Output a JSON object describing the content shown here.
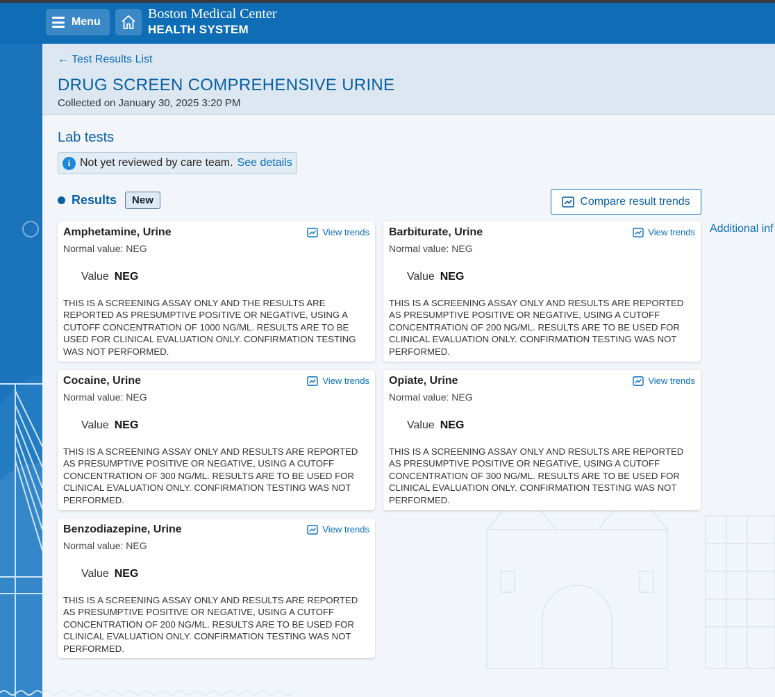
{
  "header": {
    "menu_label": "Menu",
    "logo_line1": "Boston Medical Center",
    "logo_line2": "HEALTH SYSTEM"
  },
  "page": {
    "back_link": "Test Results List",
    "title": "DRUG SCREEN COMPREHENSIVE URINE",
    "collected": "Collected on January 30, 2025 3:20 PM",
    "section_title": "Lab tests",
    "notice_text": "Not yet reviewed by care team.",
    "notice_link": "See details",
    "results_label": "Results",
    "results_badge": "New",
    "compare_button": "Compare result trends",
    "additional_link": "Additional inf"
  },
  "results": [
    {
      "name": "Amphetamine, Urine",
      "trends_label": "View trends",
      "normal": "Normal value: NEG",
      "value_label": "Value",
      "value": "NEG",
      "comment": "THIS IS A SCREENING ASSAY ONLY AND THE RESULTS ARE REPORTED AS PRESUMPTIVE POSITIVE OR NEGATIVE, USING A CUTOFF CONCENTRATION OF 1000 NG/ML. RESULTS ARE TO BE USED FOR CLINICAL EVALUATION ONLY. CONFIRMATION TESTING WAS NOT PERFORMED."
    },
    {
      "name": "Barbiturate, Urine",
      "trends_label": "View trends",
      "normal": "Normal value: NEG",
      "value_label": "Value",
      "value": "NEG",
      "comment": "THIS IS A SCREENING ASSAY ONLY AND RESULTS ARE REPORTED AS PRESUMPTIVE POSITIVE OR NEGATIVE, USING A CUTOFF CONCENTRATION OF 200 NG/ML. RESULTS ARE TO BE USED FOR CLINICAL EVALUATION ONLY. CONFIRMATION TESTING WAS NOT PERFORMED."
    },
    {
      "name": "Cocaine, Urine",
      "trends_label": "View trends",
      "normal": "Normal value: NEG",
      "value_label": "Value",
      "value": "NEG",
      "comment": "THIS IS A SCREENING ASSAY ONLY AND RESULTS ARE REPORTED AS PRESUMPTIVE POSITIVE OR NEGATIVE, USING A CUTOFF CONCENTRATION OF 300 NG/ML. RESULTS ARE TO BE USED FOR CLINICAL EVALUATION ONLY. CONFIRMATION TESTING WAS NOT PERFORMED."
    },
    {
      "name": "Opiate, Urine",
      "trends_label": "View trends",
      "normal": "Normal value: NEG",
      "value_label": "Value",
      "value": "NEG",
      "comment": "THIS IS A SCREENING ASSAY ONLY AND RESULTS ARE REPORTED AS PRESUMPTIVE POSITIVE OR NEGATIVE, USING A CUTOFF CONCENTRATION OF 300 NG/ML. RESULTS ARE TO BE USED FOR CLINICAL EVALUATION ONLY. CONFIRMATION TESTING WAS NOT PERFORMED."
    },
    {
      "name": "Benzodiazepine, Urine",
      "trends_label": "View trends",
      "normal": "Normal value: NEG",
      "value_label": "Value",
      "value": "NEG",
      "comment": "THIS IS A SCREENING ASSAY ONLY AND RESULTS ARE REPORTED AS PRESUMPTIVE POSITIVE OR NEGATIVE, USING A CUTOFF CONCENTRATION OF 200 NG/ML. RESULTS ARE TO BE USED FOR CLINICAL EVALUATION ONLY. CONFIRMATION TESTING WAS NOT PERFORMED."
    }
  ],
  "icons": {
    "menu": "hamburger-icon",
    "home": "home-icon",
    "back": "arrow-left-icon",
    "info": "info-icon",
    "trends": "trend-chart-icon"
  },
  "colors": {
    "header_bg": "#0f6db5",
    "primary_text": "#0a5fa3",
    "link": "#0a6db8",
    "page_bg": "#f2f6fa"
  }
}
